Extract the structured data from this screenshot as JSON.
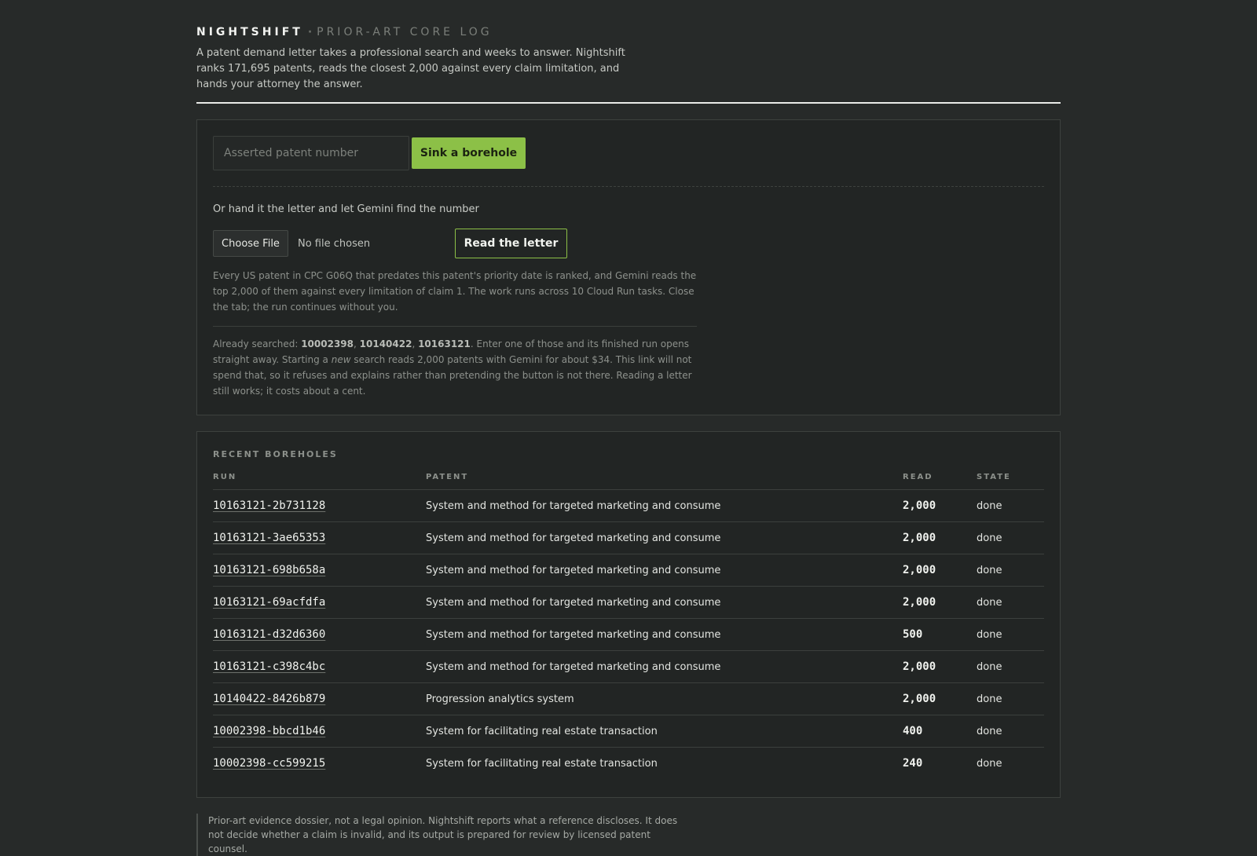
{
  "header": {
    "brand": "NIGHTSHIFT",
    "separator": "·",
    "subtitle": "PRIOR-ART CORE LOG",
    "intro": "A patent demand letter takes a professional search and weeks to answer. Nightshift ranks 171,695 patents, reads the closest 2,000 against every claim limitation, and hands your attorney the answer."
  },
  "search": {
    "placeholder": "Asserted patent number",
    "value": "",
    "submit_label": "Sink a borehole",
    "alt_label": "Or hand it the letter and let Gemini find the number",
    "choose_file_label": "Choose File",
    "file_status": "No file chosen",
    "read_letter_label": "Read the letter",
    "explanation": "Every US patent in CPC G06Q that predates this patent's priority date is ranked, and Gemini reads the top 2,000 of them against every limitation of claim 1. The work runs across 10 Cloud Run tasks. Close the tab; the run continues without you.",
    "already_prefix": "Already searched: ",
    "already_ids": [
      "10002398",
      "10140422",
      "10163121"
    ],
    "already_sep": ", ",
    "already_mid": ". Enter one of those and its finished run opens straight away. Starting a ",
    "already_emphasis": "new",
    "already_suffix": " search reads 2,000 patents with Gemini for about $34. This link will not spend that, so it refuses and explains rather than pretending the button is not there. Reading a letter still works; it costs about a cent."
  },
  "boreholes": {
    "title": "RECENT BOREHOLES",
    "columns": {
      "run": "RUN",
      "patent": "PATENT",
      "read": "READ",
      "state": "STATE"
    },
    "rows": [
      {
        "run": "10163121-2b731128",
        "patent": "System and method for targeted marketing and consume",
        "read": "2,000",
        "state": "done"
      },
      {
        "run": "10163121-3ae65353",
        "patent": "System and method for targeted marketing and consume",
        "read": "2,000",
        "state": "done"
      },
      {
        "run": "10163121-698b658a",
        "patent": "System and method for targeted marketing and consume",
        "read": "2,000",
        "state": "done"
      },
      {
        "run": "10163121-69acfdfa",
        "patent": "System and method for targeted marketing and consume",
        "read": "2,000",
        "state": "done"
      },
      {
        "run": "10163121-d32d6360",
        "patent": "System and method for targeted marketing and consume",
        "read": "500",
        "state": "done"
      },
      {
        "run": "10163121-c398c4bc",
        "patent": "System and method for targeted marketing and consume",
        "read": "2,000",
        "state": "done"
      },
      {
        "run": "10140422-8426b879",
        "patent": "Progression analytics system",
        "read": "2,000",
        "state": "done"
      },
      {
        "run": "10002398-bbcd1b46",
        "patent": "System for facilitating real estate transaction",
        "read": "400",
        "state": "done"
      },
      {
        "run": "10002398-cc599215",
        "patent": "System for facilitating real estate transaction",
        "read": "240",
        "state": "done"
      }
    ]
  },
  "disclaimer": "Prior-art evidence dossier, not a legal opinion. Nightshift reports what a reference discloses. It does not decide whether a claim is invalid, and its output is prepared for review by licensed patent counsel.",
  "colors": {
    "background": "#272a29",
    "panel": "#222524",
    "accent": "#8cc047"
  }
}
